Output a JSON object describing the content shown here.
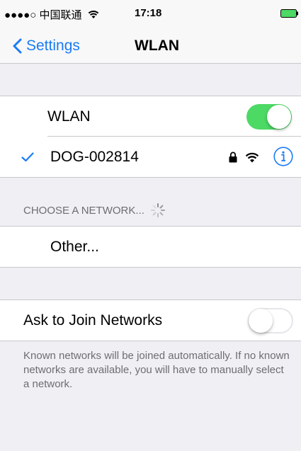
{
  "statusbar": {
    "carrier": "●●●●○ 中国联通",
    "time": "17:18"
  },
  "navbar": {
    "back_label": "Settings",
    "title": "WLAN"
  },
  "wlan": {
    "label": "WLAN",
    "enabled": true
  },
  "connected_network": {
    "name": "DOG-002814",
    "secured": true
  },
  "choose_section": {
    "header": "CHOOSE A NETWORK..."
  },
  "other": {
    "label": "Other..."
  },
  "ask_to_join": {
    "label": "Ask to Join Networks",
    "enabled": false
  },
  "footer": {
    "text": "Known networks will be joined automatically. If no known networks are available, you will have to manually select a network."
  },
  "colors": {
    "accent": "#1a7cf6",
    "switch_on": "#4cd964",
    "background": "#efeff4",
    "secondary_text": "#6d6d72"
  }
}
